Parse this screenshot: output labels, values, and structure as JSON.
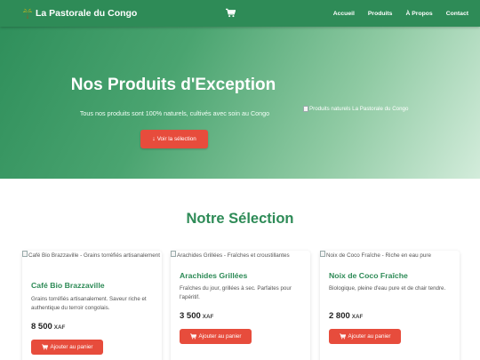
{
  "colors": {
    "primary": "#2e8b57",
    "accent": "#e74c3c"
  },
  "navbar": {
    "brand": "La Pastorale du Congo",
    "brand_icon": "palm-tree-icon",
    "cart_icon": "cart-icon",
    "links": [
      "Accueil",
      "Produits",
      "À Propos",
      "Contact"
    ]
  },
  "hero": {
    "title": "Nos Produits d'Exception",
    "subtitle": "Tous nos produits sont 100% naturels, cultivés avec soin au Congo",
    "button": "Voir la sélection",
    "image_alt": "Produits naturels La Pastorale du Congo"
  },
  "section": {
    "title": "Notre Sélection"
  },
  "products": [
    {
      "image_alt": "Café Bio Brazzaville - Grains torréfiés artisanalement",
      "name": "Café Bio Brazzaville",
      "description": "Grains torréfiés artisanalement. Saveur riche et authentique du terroir congolais.",
      "price": "8 500",
      "currency": "XAF",
      "button": "Ajouter au panier"
    },
    {
      "image_alt": "Arachides Grillées - Fraîches et croustillantes",
      "name": "Arachides Grillées",
      "description": "Fraîches du jour, grillées à sec. Parfaites pour l'apéritif.",
      "price": "3 500",
      "currency": "XAF",
      "button": "Ajouter au panier"
    },
    {
      "image_alt": "Noix de Coco Fraîche - Riche en eau pure",
      "name": "Noix de Coco Fraîche",
      "description": "Biologique, pleine d'eau pure et de chair tendre.",
      "price": "2 800",
      "currency": "XAF",
      "button": "Ajouter au panier"
    }
  ]
}
